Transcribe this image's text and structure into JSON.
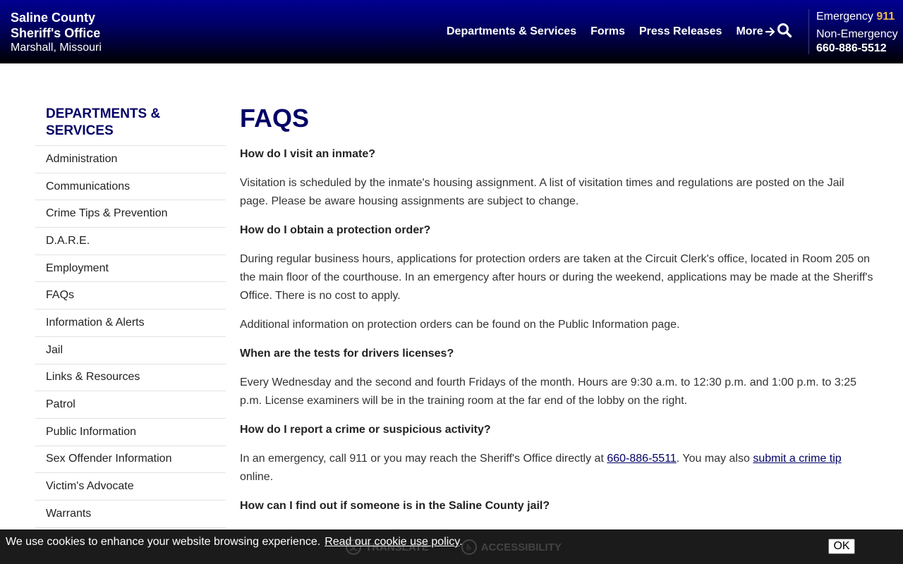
{
  "header": {
    "brand_line1": "Saline County",
    "brand_line2": "Sheriff's Office",
    "brand_line3": "Marshall, Missouri",
    "nav": {
      "departments": "Departments & Services",
      "forms": "Forms",
      "press": "Press Releases",
      "more": "More"
    },
    "search_icon": "search-icon",
    "emergency_label": "Emergency",
    "emergency_number": "911",
    "nonemergency_label": "Non-Emergency",
    "nonemergency_number": "660-886-5512",
    "colors": {
      "emergency_number": "#f0b84a",
      "header_top": "#00008f",
      "header_bottom": "#000000"
    }
  },
  "sidebar": {
    "title": "Departments & Services",
    "items": [
      "Administration",
      "Communications",
      "Crime Tips & Prevention",
      "D.A.R.E.",
      "Employment",
      "FAQs",
      "Information & Alerts",
      "Jail",
      "Links & Resources",
      "Patrol",
      "Public Information",
      "Sex Offender Information",
      "Victim's Advocate",
      "Warrants"
    ]
  },
  "main": {
    "title": "FAQS",
    "q1": "How do I visit an inmate?",
    "a1": "Visitation is scheduled by the inmate's housing assignment. A list of visitation times and regulations are posted on the Jail page. Please be aware housing assignments are subject to change.",
    "q2": "How do I obtain a protection order?",
    "a2": "During regular business hours, applications for protection orders are taken at the Circuit Clerk's office, located in Room 205 on the main floor of the courthouse. In an emergency after hours or during the weekend, applications may be made at the Sheriff's Office. There is no cost to apply.",
    "a2b": "Additional information on protection orders can be found on the Public Information page.",
    "q3": "When are the tests for drivers licenses?",
    "a3": "Every Wednesday and the second and fourth Fridays of the month. Hours are 9:30 a.m. to 12:30 p.m. and 1:00 p.m. to 3:25 p.m. License examiners will be in the training room at the far end of the lobby on the right.",
    "q4": "How do I report a crime or suspicious activity?",
    "a4_pre": "In an emergency, call 911 or you may reach the Sheriff's Office directly at ",
    "a4_phone": "660-886-5511",
    "a4_mid": ". You may also ",
    "a4_link": "submit a crime tip",
    "a4_post": " online.",
    "q5": "How can I find out if someone is in the Saline County jail?"
  },
  "cookie": {
    "message": "We use cookies to enhance your website browsing experience.",
    "link": "Read our cookie use policy",
    "link_suffix": ".",
    "ok": "OK",
    "ghost_translate": "TRANSLATE",
    "ghost_accessibility": "ACCESSIBILITY"
  }
}
